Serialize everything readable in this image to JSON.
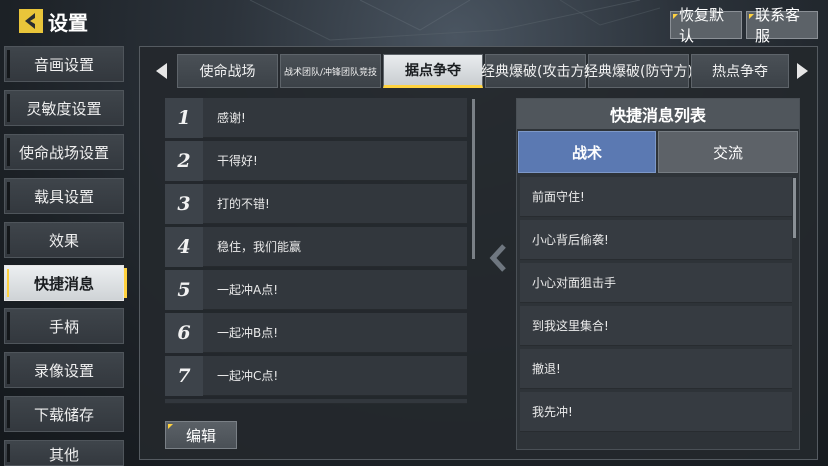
{
  "header": {
    "title": "设置",
    "restore_label": "恢复默认",
    "support_label": "联系客服"
  },
  "sidebar": {
    "items": [
      {
        "label": "音画设置",
        "active": false
      },
      {
        "label": "灵敏度设置",
        "active": false
      },
      {
        "label": "使命战场设置",
        "active": false
      },
      {
        "label": "载具设置",
        "active": false
      },
      {
        "label": "效果",
        "active": false
      },
      {
        "label": "快捷消息",
        "active": true
      },
      {
        "label": "手柄",
        "active": false
      },
      {
        "label": "录像设置",
        "active": false
      },
      {
        "label": "下载储存",
        "active": false
      },
      {
        "label": "其他",
        "active": false
      }
    ]
  },
  "mode_tabs": [
    {
      "label": "使命战场",
      "active": false
    },
    {
      "label": "战术团队/冲锋团队竞技",
      "active": false
    },
    {
      "label": "据点争夺",
      "active": true
    },
    {
      "label": "经典爆破(攻击方)",
      "active": false
    },
    {
      "label": "经典爆破(防守方)",
      "active": false
    },
    {
      "label": "热点争夺",
      "active": false
    }
  ],
  "message_slots": [
    {
      "num": "1",
      "text": "感谢!"
    },
    {
      "num": "2",
      "text": "干得好!"
    },
    {
      "num": "3",
      "text": "打的不错!"
    },
    {
      "num": "4",
      "text": "稳住，我们能赢"
    },
    {
      "num": "5",
      "text": "一起冲A点!"
    },
    {
      "num": "6",
      "text": "一起冲B点!"
    },
    {
      "num": "7",
      "text": "一起冲C点!"
    }
  ],
  "edit_label": "编辑",
  "quick_list": {
    "title": "快捷消息列表",
    "tabs": [
      {
        "label": "战术",
        "active": true
      },
      {
        "label": "交流",
        "active": false
      }
    ],
    "items": [
      "前面守住!",
      "小心背后偷袭!",
      "小心对面狙击手",
      "到我这里集合!",
      "撤退!",
      "我先冲!"
    ]
  },
  "colors": {
    "accent": "#ffd23f",
    "active_tab_blue": "#5b79b2"
  },
  "icons": [
    "back-arrow-icon",
    "tab-left-arrow-icon",
    "tab-right-arrow-icon",
    "transfer-arrow-icon"
  ]
}
